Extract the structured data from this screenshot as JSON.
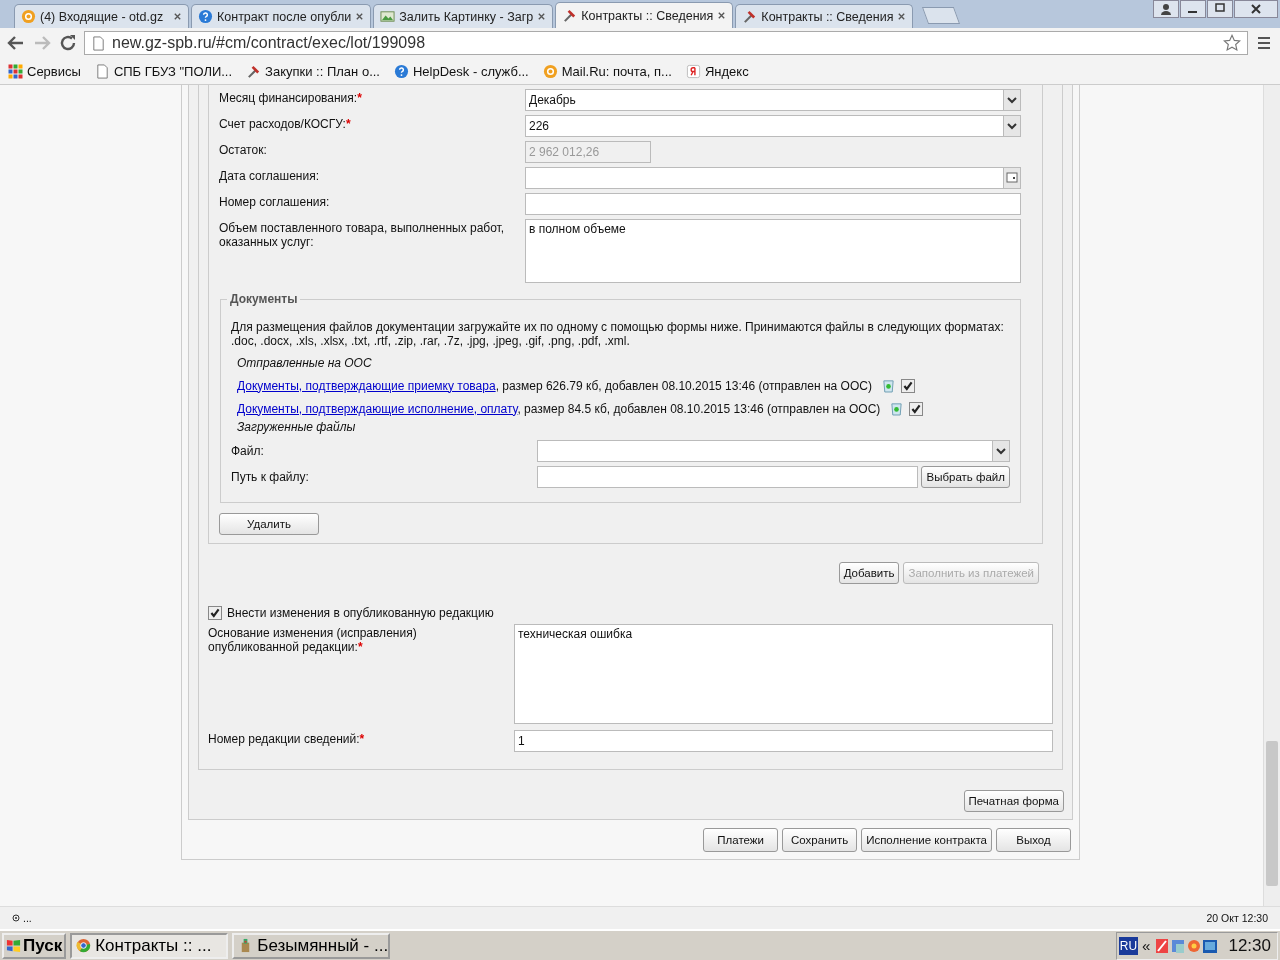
{
  "browser": {
    "tabs": [
      {
        "title": "(4) Входящие - otd.gz",
        "selected": false
      },
      {
        "title": "Контракт после опубли",
        "selected": false
      },
      {
        "title": "Залить Картинку - Загр",
        "selected": false
      },
      {
        "title": "Контракты :: Сведения",
        "selected": true
      },
      {
        "title": "Контракты :: Сведения",
        "selected": false
      }
    ],
    "address": "new.gz-spb.ru/#cm/contract/exec/lot/199098",
    "bookmarks": [
      {
        "label": "Сервисы"
      },
      {
        "label": "СПБ ГБУЗ \"ПОЛИ..."
      },
      {
        "label": "Закупки :: План о..."
      },
      {
        "label": "HelpDesk - служб..."
      },
      {
        "label": "Mail.Ru: почта, п..."
      },
      {
        "label": "Яндекс"
      }
    ]
  },
  "form": {
    "fields": [
      {
        "label": "Месяц финансирования:",
        "required_mark": "*",
        "kind": "select",
        "value": "Декабрь"
      },
      {
        "label": "Счет расходов/КОСГУ:",
        "required_mark": "*",
        "kind": "select",
        "value": "226"
      },
      {
        "label": "Остаток:",
        "kind": "readonly",
        "value": "2 962 012,26"
      },
      {
        "label": "Дата соглашения:",
        "kind": "date"
      },
      {
        "label": "Номер соглашения:",
        "kind": "text"
      },
      {
        "label": "Объем поставленного товара, выполненных работ, оказанных услуг:",
        "kind": "textarea",
        "value": "в полном объеме"
      }
    ],
    "documents": {
      "legend": "Документы",
      "note": "Для размещения файлов документации загружайте их по одному с помощью формы ниже. Принимаются файлы в следующих форматах: .doc, .docx, .xls, .xlsx, .txt, .rtf, .zip, .rar, .7z, .jpg, .jpeg, .gif, .png, .pdf, .xml.",
      "sent_heading": "Отправленные на ООС",
      "sent_files": [
        {
          "link": "Документы, подтверждающие приемку товара",
          "details": ", размер 626.79 кб, добавлен 08.10.2015 13:46 (отправлен на ООС)",
          "checked": true
        },
        {
          "link": "Документы, подтверждающие исполнение, оплату",
          "details": ", размер 84.5 кб, добавлен 08.10.2015 13:46 (отправлен на ООС)",
          "checked": true
        }
      ],
      "uploaded_heading": "Загруженные файлы",
      "file_label": "Файл:",
      "path_label": "Путь к файлу:",
      "choose_button": "Выбрать файл"
    },
    "delete_button": "Удалить",
    "actions": [
      {
        "label": "Добавить",
        "disabled": false
      },
      {
        "label": "Заполнить из платежей",
        "disabled": true
      }
    ],
    "change_checkbox": {
      "label": "Внести изменения в опубликованную редакцию",
      "checked": true
    },
    "change_fields": [
      {
        "label": "Основание изменения (исправления) опубликованной редакции:",
        "required_mark": "*",
        "kind": "textarea",
        "value": "техническая ошибка"
      },
      {
        "label": "Номер редакции сведений:",
        "required_mark": "*",
        "kind": "text",
        "value": "1"
      }
    ],
    "print_button": "Печатная форма",
    "footer_buttons": [
      "Платежи",
      "Сохранить",
      "Исполнение контракта",
      "Выход"
    ]
  },
  "status_bar": {
    "left": "...",
    "right": "20 Окт 12:30"
  },
  "taskbar": {
    "start": "Пуск",
    "items": [
      {
        "label": "Контракты :: ...",
        "selected": true
      },
      {
        "label": "Безымянный - ...",
        "selected": false
      }
    ],
    "language": "RU",
    "expand": "«",
    "clock": "12:30"
  }
}
